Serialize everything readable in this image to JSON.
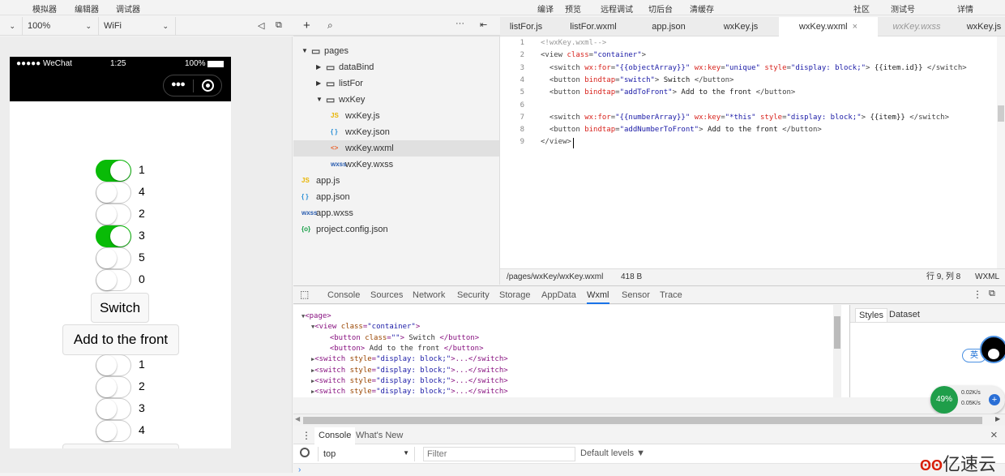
{
  "menu": {
    "left": [
      "模拟器",
      "编辑器",
      "调试器"
    ],
    "center": [
      "编译",
      "预览",
      "远程调试",
      "切后台",
      "清缓存"
    ],
    "right": [
      "社区",
      "测试号",
      "详情"
    ]
  },
  "toolbar": {
    "device_chevron": "⌄",
    "zoom": "100%",
    "network": "WiFi"
  },
  "phone": {
    "carrier": "●●●●● WeChat",
    "time": "1:25",
    "battery": "100%"
  },
  "switches_top": [
    {
      "label": "1",
      "checked": true
    },
    {
      "label": "4",
      "checked": false
    },
    {
      "label": "2",
      "checked": false
    },
    {
      "label": "3",
      "checked": true
    },
    {
      "label": "5",
      "checked": false
    },
    {
      "label": "0",
      "checked": false
    }
  ],
  "buttons": {
    "switch": "Switch",
    "add_front": "Add to the front"
  },
  "switches_bottom": [
    {
      "label": "1",
      "checked": false
    },
    {
      "label": "2",
      "checked": false
    },
    {
      "label": "3",
      "checked": false
    },
    {
      "label": "4",
      "checked": false
    }
  ],
  "tree": [
    {
      "label": "pages",
      "icon": "folder-open-icon",
      "arrow": "▼",
      "indent": 0
    },
    {
      "label": "dataBind",
      "icon": "folder-icon",
      "arrow": "▶",
      "indent": 1
    },
    {
      "label": "listFor",
      "icon": "folder-icon",
      "arrow": "▶",
      "indent": 1
    },
    {
      "label": "wxKey",
      "icon": "folder-open-icon",
      "arrow": "▼",
      "indent": 1
    },
    {
      "label": "wxKey.js",
      "icon": "js-file-icon",
      "glyph": "JS",
      "indent": 2
    },
    {
      "label": "wxKey.json",
      "icon": "json-file-icon",
      "glyph": "{ }",
      "indent": 2
    },
    {
      "label": "wxKey.wxml",
      "icon": "wxml-file-icon",
      "glyph": "<>",
      "indent": 2,
      "selected": true
    },
    {
      "label": "wxKey.wxss",
      "icon": "wxss-file-icon",
      "glyph": "wxss",
      "indent": 2
    },
    {
      "label": "app.js",
      "icon": "js-file-icon",
      "glyph": "JS",
      "indent": 0
    },
    {
      "label": "app.json",
      "icon": "json-file-icon",
      "glyph": "{ }",
      "indent": 0
    },
    {
      "label": "app.wxss",
      "icon": "wxss-file-icon",
      "glyph": "wxss",
      "indent": 0
    },
    {
      "label": "project.config.json",
      "icon": "config-file-icon",
      "glyph": "{o}",
      "indent": 0
    }
  ],
  "tabs": [
    {
      "label": "listFor.js"
    },
    {
      "label": "listFor.wxml"
    },
    {
      "label": "app.json"
    },
    {
      "label": "wxKey.js"
    },
    {
      "label": "wxKey.wxml",
      "active": true,
      "close": "×"
    },
    {
      "label": "wxKey.wxss",
      "italic": true
    },
    {
      "label": "wxKey.js"
    }
  ],
  "code": [
    [
      [
        "cm",
        "<!wxKey.wxml-->"
      ]
    ],
    [
      [
        "tag",
        "<view "
      ],
      [
        "attr",
        "class"
      ],
      [
        "tag",
        "="
      ],
      [
        "val",
        "\"container\""
      ],
      [
        "tag",
        ">"
      ]
    ],
    [
      [
        "tx",
        "  "
      ],
      [
        "tag",
        "<switch "
      ],
      [
        "attr",
        "wx:for"
      ],
      [
        "tag",
        "="
      ],
      [
        "val",
        "\"{{objectArray}}\""
      ],
      [
        "tx",
        " "
      ],
      [
        "attr",
        "wx:key"
      ],
      [
        "tag",
        "="
      ],
      [
        "val",
        "\"unique\""
      ],
      [
        "tx",
        " "
      ],
      [
        "attr",
        "style"
      ],
      [
        "tag",
        "="
      ],
      [
        "val",
        "\"display: block;\""
      ],
      [
        "tag",
        ">"
      ],
      [
        "tx",
        " {{item.id}} "
      ],
      [
        "tag",
        "</switch>"
      ]
    ],
    [
      [
        "tx",
        "  "
      ],
      [
        "tag",
        "<button "
      ],
      [
        "attr",
        "bindtap"
      ],
      [
        "tag",
        "="
      ],
      [
        "val",
        "\"switch\""
      ],
      [
        "tag",
        ">"
      ],
      [
        "tx",
        " Switch "
      ],
      [
        "tag",
        "</button>"
      ]
    ],
    [
      [
        "tx",
        "  "
      ],
      [
        "tag",
        "<button "
      ],
      [
        "attr",
        "bindtap"
      ],
      [
        "tag",
        "="
      ],
      [
        "val",
        "\"addToFront\""
      ],
      [
        "tag",
        ">"
      ],
      [
        "tx",
        " Add to the front "
      ],
      [
        "tag",
        "</button>"
      ]
    ],
    [
      [
        "tx",
        ""
      ]
    ],
    [
      [
        "tx",
        "  "
      ],
      [
        "tag",
        "<switch "
      ],
      [
        "attr",
        "wx:for"
      ],
      [
        "tag",
        "="
      ],
      [
        "val",
        "\"{{numberArray}}\""
      ],
      [
        "tx",
        " "
      ],
      [
        "attr",
        "wx:key"
      ],
      [
        "tag",
        "="
      ],
      [
        "val",
        "\"*this\""
      ],
      [
        "tx",
        " "
      ],
      [
        "attr",
        "style"
      ],
      [
        "tag",
        "="
      ],
      [
        "val",
        "\"display: block;\""
      ],
      [
        "tag",
        ">"
      ],
      [
        "tx",
        " {{item}} "
      ],
      [
        "tag",
        "</switch>"
      ]
    ],
    [
      [
        "tx",
        "  "
      ],
      [
        "tag",
        "<button "
      ],
      [
        "attr",
        "bindtap"
      ],
      [
        "tag",
        "="
      ],
      [
        "val",
        "\"addNumberToFront\""
      ],
      [
        "tag",
        ">"
      ],
      [
        "tx",
        " Add to the front "
      ],
      [
        "tag",
        "</button>"
      ]
    ],
    [
      [
        "tag",
        "</view>"
      ]
    ]
  ],
  "editor_status": {
    "path": "/pages/wxKey/wxKey.wxml",
    "size": "418 B",
    "position": "行 9, 列 8",
    "lang": "WXML"
  },
  "devtools_tabs": [
    "Console",
    "Sources",
    "Network",
    "Security",
    "Storage",
    "AppData",
    "Wxml",
    "Sensor",
    "Trace"
  ],
  "devtools_active": "Wxml",
  "wxml_tree": [
    {
      "indent": 0,
      "arrow": "▼",
      "parts": [
        [
          "tag",
          "<page>"
        ]
      ]
    },
    {
      "indent": 1,
      "arrow": "▼",
      "parts": [
        [
          "tag",
          "<view "
        ],
        [
          "attr",
          "class"
        ],
        [
          "tag",
          "="
        ],
        [
          "val",
          "\"container\""
        ],
        [
          "tag",
          ">"
        ]
      ]
    },
    {
      "indent": 2,
      "arrow": "",
      "parts": [
        [
          "tag",
          "<button "
        ],
        [
          "attr",
          "class"
        ],
        [
          "tag",
          "="
        ],
        [
          "val",
          "\"\""
        ],
        [
          "tag",
          ">"
        ],
        [
          "tx",
          " Switch "
        ],
        [
          "tag",
          "</button>"
        ]
      ]
    },
    {
      "indent": 2,
      "arrow": "",
      "parts": [
        [
          "tag",
          "<button>"
        ],
        [
          "tx",
          " Add to the front "
        ],
        [
          "tag",
          "</button>"
        ]
      ]
    },
    {
      "indent": 1,
      "arrow": "▶",
      "parts": [
        [
          "tag",
          "<switch "
        ],
        [
          "attr",
          "style"
        ],
        [
          "tag",
          "="
        ],
        [
          "val",
          "\"display: block;\""
        ],
        [
          "tag",
          ">...</switch>"
        ]
      ]
    },
    {
      "indent": 1,
      "arrow": "▶",
      "parts": [
        [
          "tag",
          "<switch "
        ],
        [
          "attr",
          "style"
        ],
        [
          "tag",
          "="
        ],
        [
          "val",
          "\"display: block;\""
        ],
        [
          "tag",
          ">...</switch>"
        ]
      ]
    },
    {
      "indent": 1,
      "arrow": "▶",
      "parts": [
        [
          "tag",
          "<switch "
        ],
        [
          "attr",
          "style"
        ],
        [
          "tag",
          "="
        ],
        [
          "val",
          "\"display: block;\""
        ],
        [
          "tag",
          ">...</switch>"
        ]
      ]
    },
    {
      "indent": 1,
      "arrow": "▶",
      "parts": [
        [
          "tag",
          "<switch "
        ],
        [
          "attr",
          "style"
        ],
        [
          "tag",
          "="
        ],
        [
          "val",
          "\"display: block;\""
        ],
        [
          "tag",
          ">...</switch>"
        ]
      ]
    }
  ],
  "styles_tabs": [
    "Styles",
    "Dataset"
  ],
  "overlay": {
    "ime": "英",
    "cpu": "49%",
    "up": "0.02K/s",
    "down": "0.05K/s",
    "watermark": "亿速云"
  },
  "console": {
    "tabs": [
      "Console",
      "What's New"
    ],
    "context": "top",
    "filter_placeholder": "Filter",
    "levels": "Default levels ▼",
    "close": "×"
  },
  "colors": {
    "switch_on": "#09bb07",
    "accent": "#1a73e8"
  }
}
